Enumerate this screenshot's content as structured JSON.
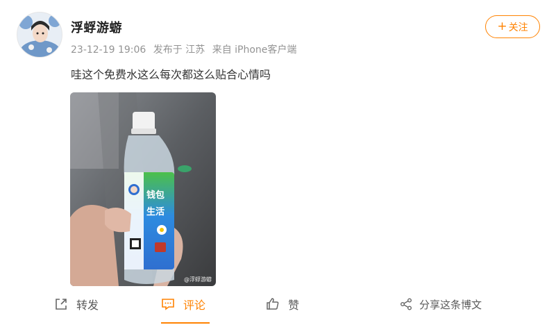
{
  "post": {
    "username": "浮蜉游蝣",
    "date": "23-12-19 19:06",
    "location": "发布于 江苏",
    "source": "来自 iPhone客户端",
    "text": "哇这个免费水这么每次都这么贴合心情吗",
    "follow_label": "关注",
    "follow_plus": "+"
  },
  "image": {
    "label_line1": "钱包",
    "label_line2": "生活",
    "watermark": "@浮蜉游蝣"
  },
  "actions": {
    "repost": "转发",
    "comment": "评论",
    "like": "赞",
    "share": "分享这条博文"
  },
  "colors": {
    "accent": "#ff8200",
    "meta": "#939393",
    "text": "#333333"
  }
}
